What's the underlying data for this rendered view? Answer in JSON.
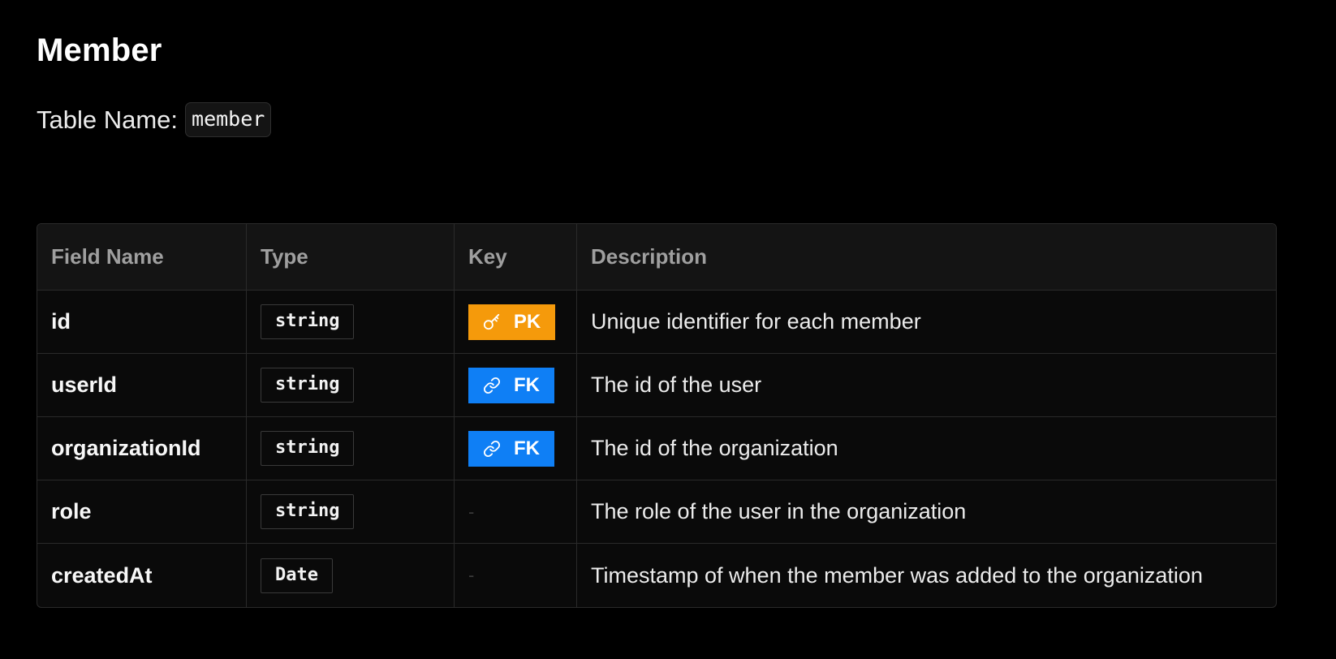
{
  "title": "Member",
  "table_name_label": "Table Name:",
  "table_name_value": "member",
  "columns": {
    "field": "Field Name",
    "type": "Type",
    "key": "Key",
    "description": "Description"
  },
  "rows": [
    {
      "field": "id",
      "type": "string",
      "key": "PK",
      "key_icon": "key-icon",
      "description": "Unique identifier for each member"
    },
    {
      "field": "userId",
      "type": "string",
      "key": "FK",
      "key_icon": "link-icon",
      "description": "The id of the user"
    },
    {
      "field": "organizationId",
      "type": "string",
      "key": "FK",
      "key_icon": "link-icon",
      "description": "The id of the organization"
    },
    {
      "field": "role",
      "type": "string",
      "key": "-",
      "description": "The role of the user in the organization"
    },
    {
      "field": "createdAt",
      "type": "Date",
      "key": "-",
      "description": "Timestamp of when the member was added to the organization"
    }
  ],
  "colors": {
    "pk_badge": "#f59a0b",
    "fk_badge": "#0f7ff5",
    "background": "#000000"
  }
}
